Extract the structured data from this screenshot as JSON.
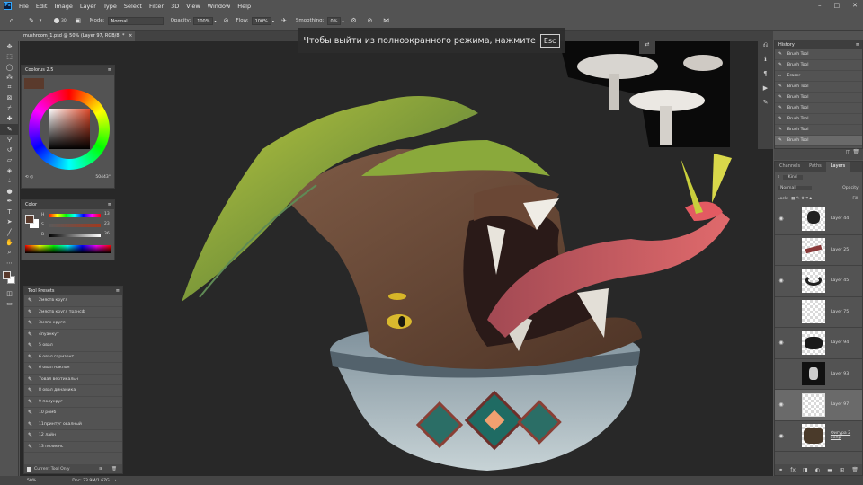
{
  "menu": [
    "File",
    "Edit",
    "Image",
    "Layer",
    "Type",
    "Select",
    "Filter",
    "3D",
    "View",
    "Window",
    "Help"
  ],
  "app_logo": "Ps",
  "options": {
    "brush_size": "30",
    "mode_label": "Mode:",
    "mode_value": "Normal",
    "opacity_label": "Opacity:",
    "opacity_value": "100%",
    "flow_label": "Flow:",
    "flow_value": "100%",
    "smoothing_label": "Smoothing:",
    "smoothing_value": "0%"
  },
  "document": {
    "tab_title": "mushroom_1.psd @ 50% (Layer 97, RGB/8) *",
    "close": "×"
  },
  "fullscreen_notice": {
    "text": "Чтобы выйти из полноэкранного режима, нажмите",
    "key": "Esc"
  },
  "coolorus": {
    "title": "Coolorus 2.5",
    "angle_readout": "50443°"
  },
  "color_panel": {
    "title": "Color",
    "sliders": [
      {
        "label": "H",
        "value": "13",
        "unit": "°"
      },
      {
        "label": "S",
        "value": "23",
        "unit": "%"
      },
      {
        "label": "B",
        "value": "36",
        "unit": "%"
      }
    ]
  },
  "tool_presets": {
    "title": "Tool Presets",
    "items": [
      "2мяств кругл",
      "2мяств кругл трансф",
      "3мягк кругл",
      "4пуанкут",
      "5 овал",
      "6 овал горизонт",
      "6 овал наклон",
      "7овал вертикальн",
      "8 овал динамика",
      "9 полукруг",
      "10 ромб",
      "11принтуг овалный",
      "12 лайн",
      "13 полиенс"
    ],
    "footer_checkbox": "Current Tool Only"
  },
  "history": {
    "title": "History",
    "items": [
      "Brush Tool",
      "Brush Tool",
      "Eraser",
      "Brush Tool",
      "Brush Tool",
      "Brush Tool",
      "Brush Tool",
      "Brush Tool",
      "Brush Tool"
    ],
    "selected_index": 8
  },
  "layers_panel": {
    "tabs": [
      "Channels",
      "Paths",
      "Layers"
    ],
    "active_tab": "Layers",
    "filter_label": "Kind",
    "blend_mode": "Normal",
    "opacity_label": "Opacity:",
    "lock_label": "Lock:",
    "fill_label": "Fill:",
    "layers": [
      {
        "name": "Layer 44",
        "visible": true
      },
      {
        "name": "Layer 25",
        "visible": false
      },
      {
        "name": "Layer 45",
        "visible": true
      },
      {
        "name": "Layer 75",
        "visible": false
      },
      {
        "name": "Layer 94",
        "visible": true
      },
      {
        "name": "Layer 93",
        "visible": false
      },
      {
        "name": "Layer 97",
        "visible": true,
        "selected": true
      },
      {
        "name": "Фигура 2 копр",
        "visible": true
      }
    ]
  },
  "status": {
    "zoom": "50%",
    "doc": "Doc: 23.9M/1.67G"
  },
  "colors": {
    "ui_panel": "#535353",
    "canvas_bg": "#282828",
    "foreground_swatch": "#5a3a2c",
    "background_swatch": "#ffffff"
  }
}
